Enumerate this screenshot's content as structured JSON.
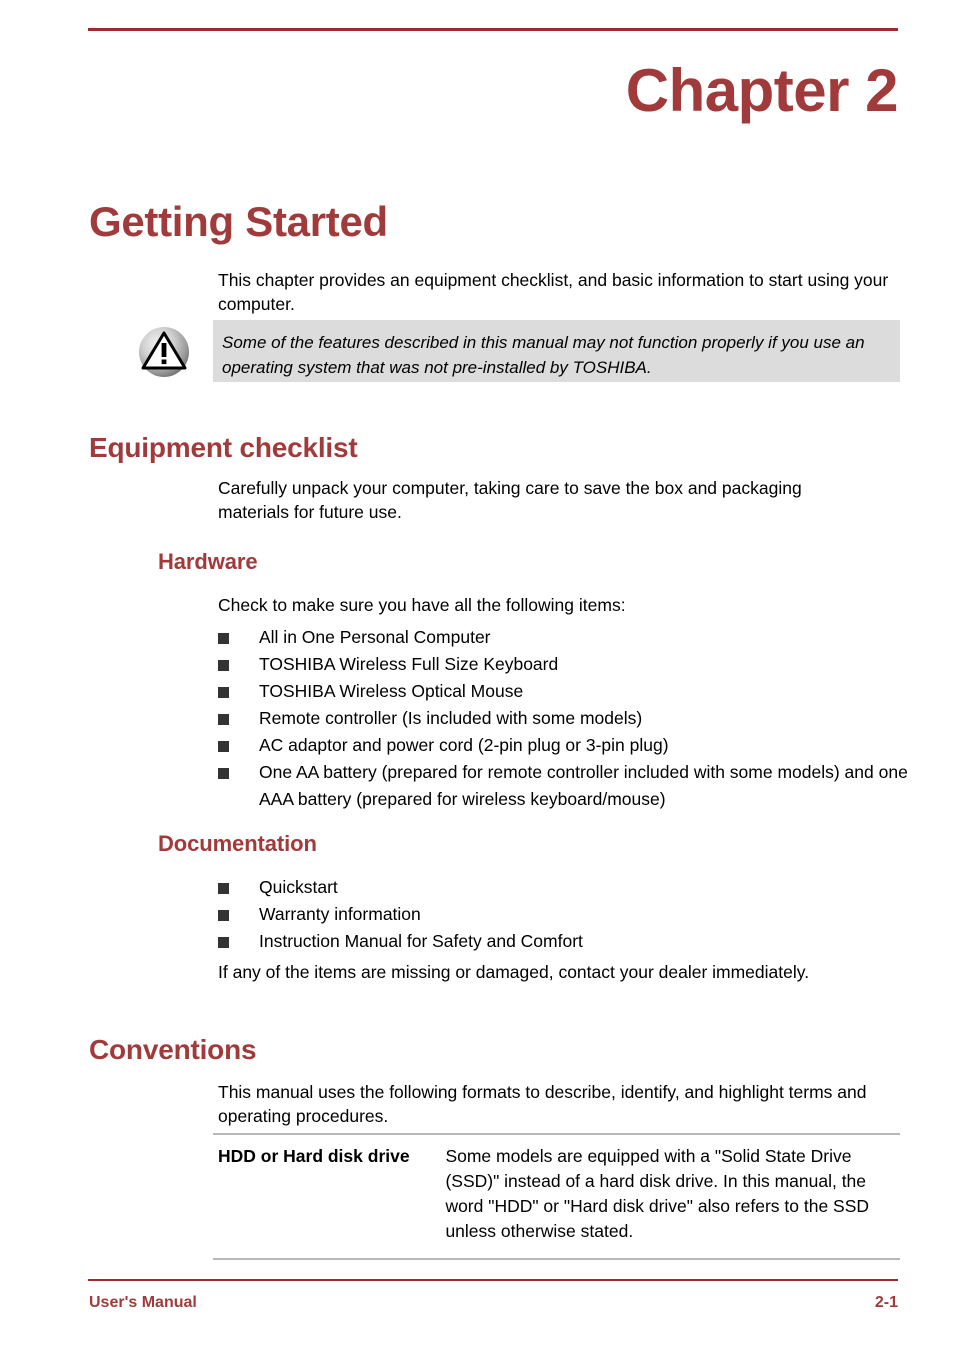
{
  "header": {
    "rule_color": "#9e2b2b"
  },
  "chapter": {
    "label": "Chapter 2",
    "title": "Getting Started",
    "intro": "This chapter provides an equipment checklist, and basic information to start using your computer."
  },
  "note": {
    "icon": "warning-triangle-icon",
    "text": "Some of the features described in this manual may not function properly if you use an operating system that was not pre-installed by TOSHIBA.",
    "background": "#dcdcdc"
  },
  "equipment": {
    "heading": "Equipment checklist",
    "intro": "Carefully unpack your computer, taking care to save the box and packaging materials for future use.",
    "hardware": {
      "heading": "Hardware",
      "intro": "Check to make sure you have all the following items:",
      "items": [
        "All in One Personal Computer",
        "TOSHIBA Wireless Full Size Keyboard",
        "TOSHIBA Wireless Optical Mouse",
        "Remote controller (Is included with some models)",
        "AC adaptor and power cord (2-pin plug or 3-pin plug)",
        "One AA battery (prepared for remote controller included with some models) and one AAA battery (prepared for wireless keyboard/mouse)"
      ]
    },
    "documentation": {
      "heading": "Documentation",
      "items": [
        "Quickstart",
        "Warranty information",
        "Instruction Manual for Safety and Comfort"
      ],
      "closing": "If any of the items are missing or damaged, contact your dealer immediately."
    }
  },
  "conventions": {
    "heading": "Conventions",
    "intro": "This manual uses the following formats to describe, identify, and highlight terms and operating procedures.",
    "rows": [
      {
        "term": "HDD or Hard disk drive",
        "description": "Some models are equipped with a \"Solid State Drive (SSD)\" instead of a hard disk drive. In this manual, the word \"HDD\" or \"Hard disk drive\" also refers to the SSD unless otherwise stated."
      }
    ]
  },
  "footer": {
    "left": "User's Manual",
    "page": "2-1",
    "accent": "#a13b3b"
  }
}
